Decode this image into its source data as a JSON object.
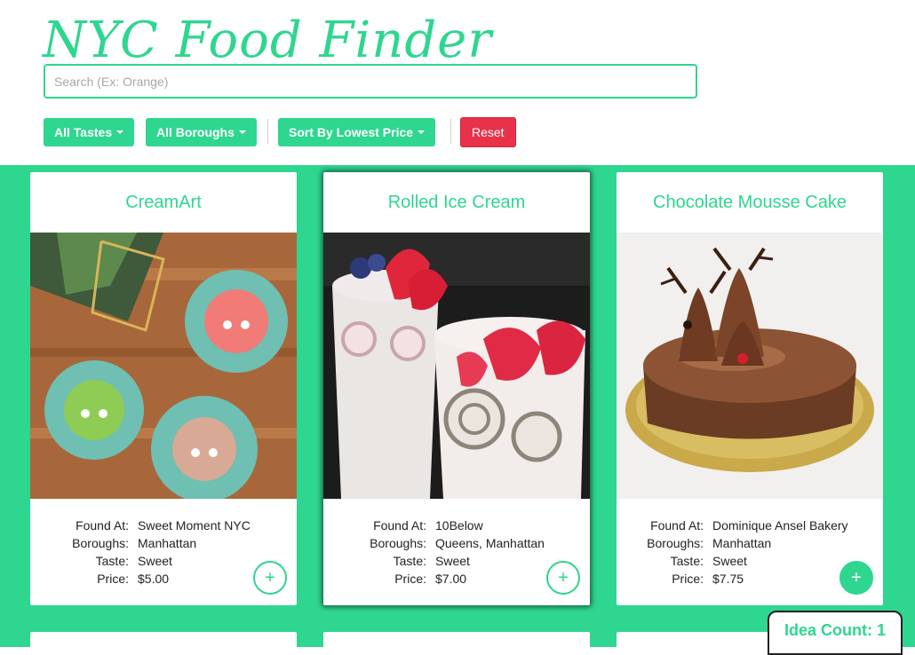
{
  "app": {
    "title": "NYC Food Finder"
  },
  "search": {
    "placeholder": "Search (Ex: Orange)",
    "value": ""
  },
  "filters": {
    "taste": "All Tastes",
    "borough": "All Boroughs",
    "sort": "Sort By Lowest Price",
    "reset": "Reset"
  },
  "labels": {
    "found_at": "Found At:",
    "boroughs": "Boroughs:",
    "taste": "Taste:",
    "price": "Price:"
  },
  "cards": [
    {
      "title": "CreamArt",
      "found_at": "Sweet Moment NYC",
      "boroughs": "Manhattan",
      "taste": "Sweet",
      "price": "$5.00",
      "added": false
    },
    {
      "title": "Rolled Ice Cream",
      "found_at": "10Below",
      "boroughs": "Queens, Manhattan",
      "taste": "Sweet",
      "price": "$7.00",
      "added": false
    },
    {
      "title": "Chocolate Mousse Cake",
      "found_at": "Dominique Ansel Bakery",
      "boroughs": "Manhattan",
      "taste": "Sweet",
      "price": "$7.75",
      "added": true
    }
  ],
  "add_icon": "+",
  "idea_count": {
    "text": "Idea Count: 1"
  },
  "colors": {
    "accent": "#2ed68f",
    "reset": "#e8324a"
  }
}
